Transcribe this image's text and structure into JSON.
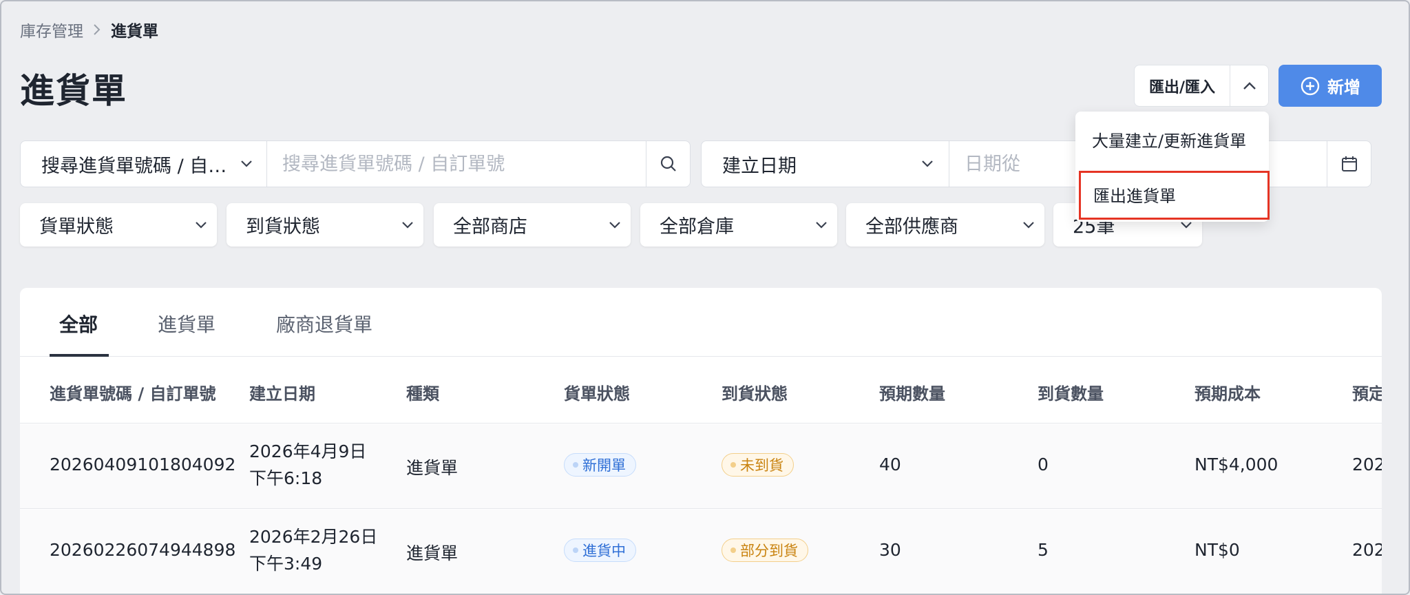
{
  "breadcrumb": {
    "parent": "庫存管理",
    "current": "進貨單"
  },
  "page_title": "進貨單",
  "header": {
    "io_label": "匯出/匯入",
    "add_label": "新增"
  },
  "dropdown": {
    "items": [
      "大量建立/更新進貨單",
      "匯出進貨單"
    ]
  },
  "search": {
    "type": "搜尋進貨單號碼 / 自…",
    "placeholder": "搜尋進貨單號碼 / 自訂單號"
  },
  "date_filter": {
    "type": "建立日期",
    "from_placeholder": "日期從"
  },
  "filters": [
    "貨單狀態",
    "到貨狀態",
    "全部商店",
    "全部倉庫",
    "全部供應商",
    "25筆"
  ],
  "tabs": [
    "全部",
    "進貨單",
    "廠商退貨單"
  ],
  "columns": [
    "進貨單號碼 / 自訂單號",
    "建立日期",
    "種類",
    "貨單狀態",
    "到貨狀態",
    "預期數量",
    "到貨數量",
    "預期成本",
    "預定"
  ],
  "rows": [
    {
      "number": "20260409101804092",
      "date_line1": "2026年4月9日",
      "date_line2": "下午6:18",
      "type": "進貨單",
      "order_status": "新開單",
      "arrival_status": "未到貨",
      "expected_qty": "40",
      "arrived_qty": "0",
      "expected_cost": "NT$4,000",
      "scheduled": "202"
    },
    {
      "number": "20260226074944898",
      "date_line1": "2026年2月26日",
      "date_line2": "下午3:49",
      "type": "進貨單",
      "order_status": "進貨中",
      "arrival_status": "部分到貨",
      "expected_qty": "30",
      "arrived_qty": "5",
      "expected_cost": "NT$0",
      "scheduled": "202"
    }
  ],
  "colors": {
    "primary": "#4f8ae8",
    "highlight": "#e53424",
    "status_blue": "#2f6fd6",
    "status_orange": "#c98310"
  }
}
